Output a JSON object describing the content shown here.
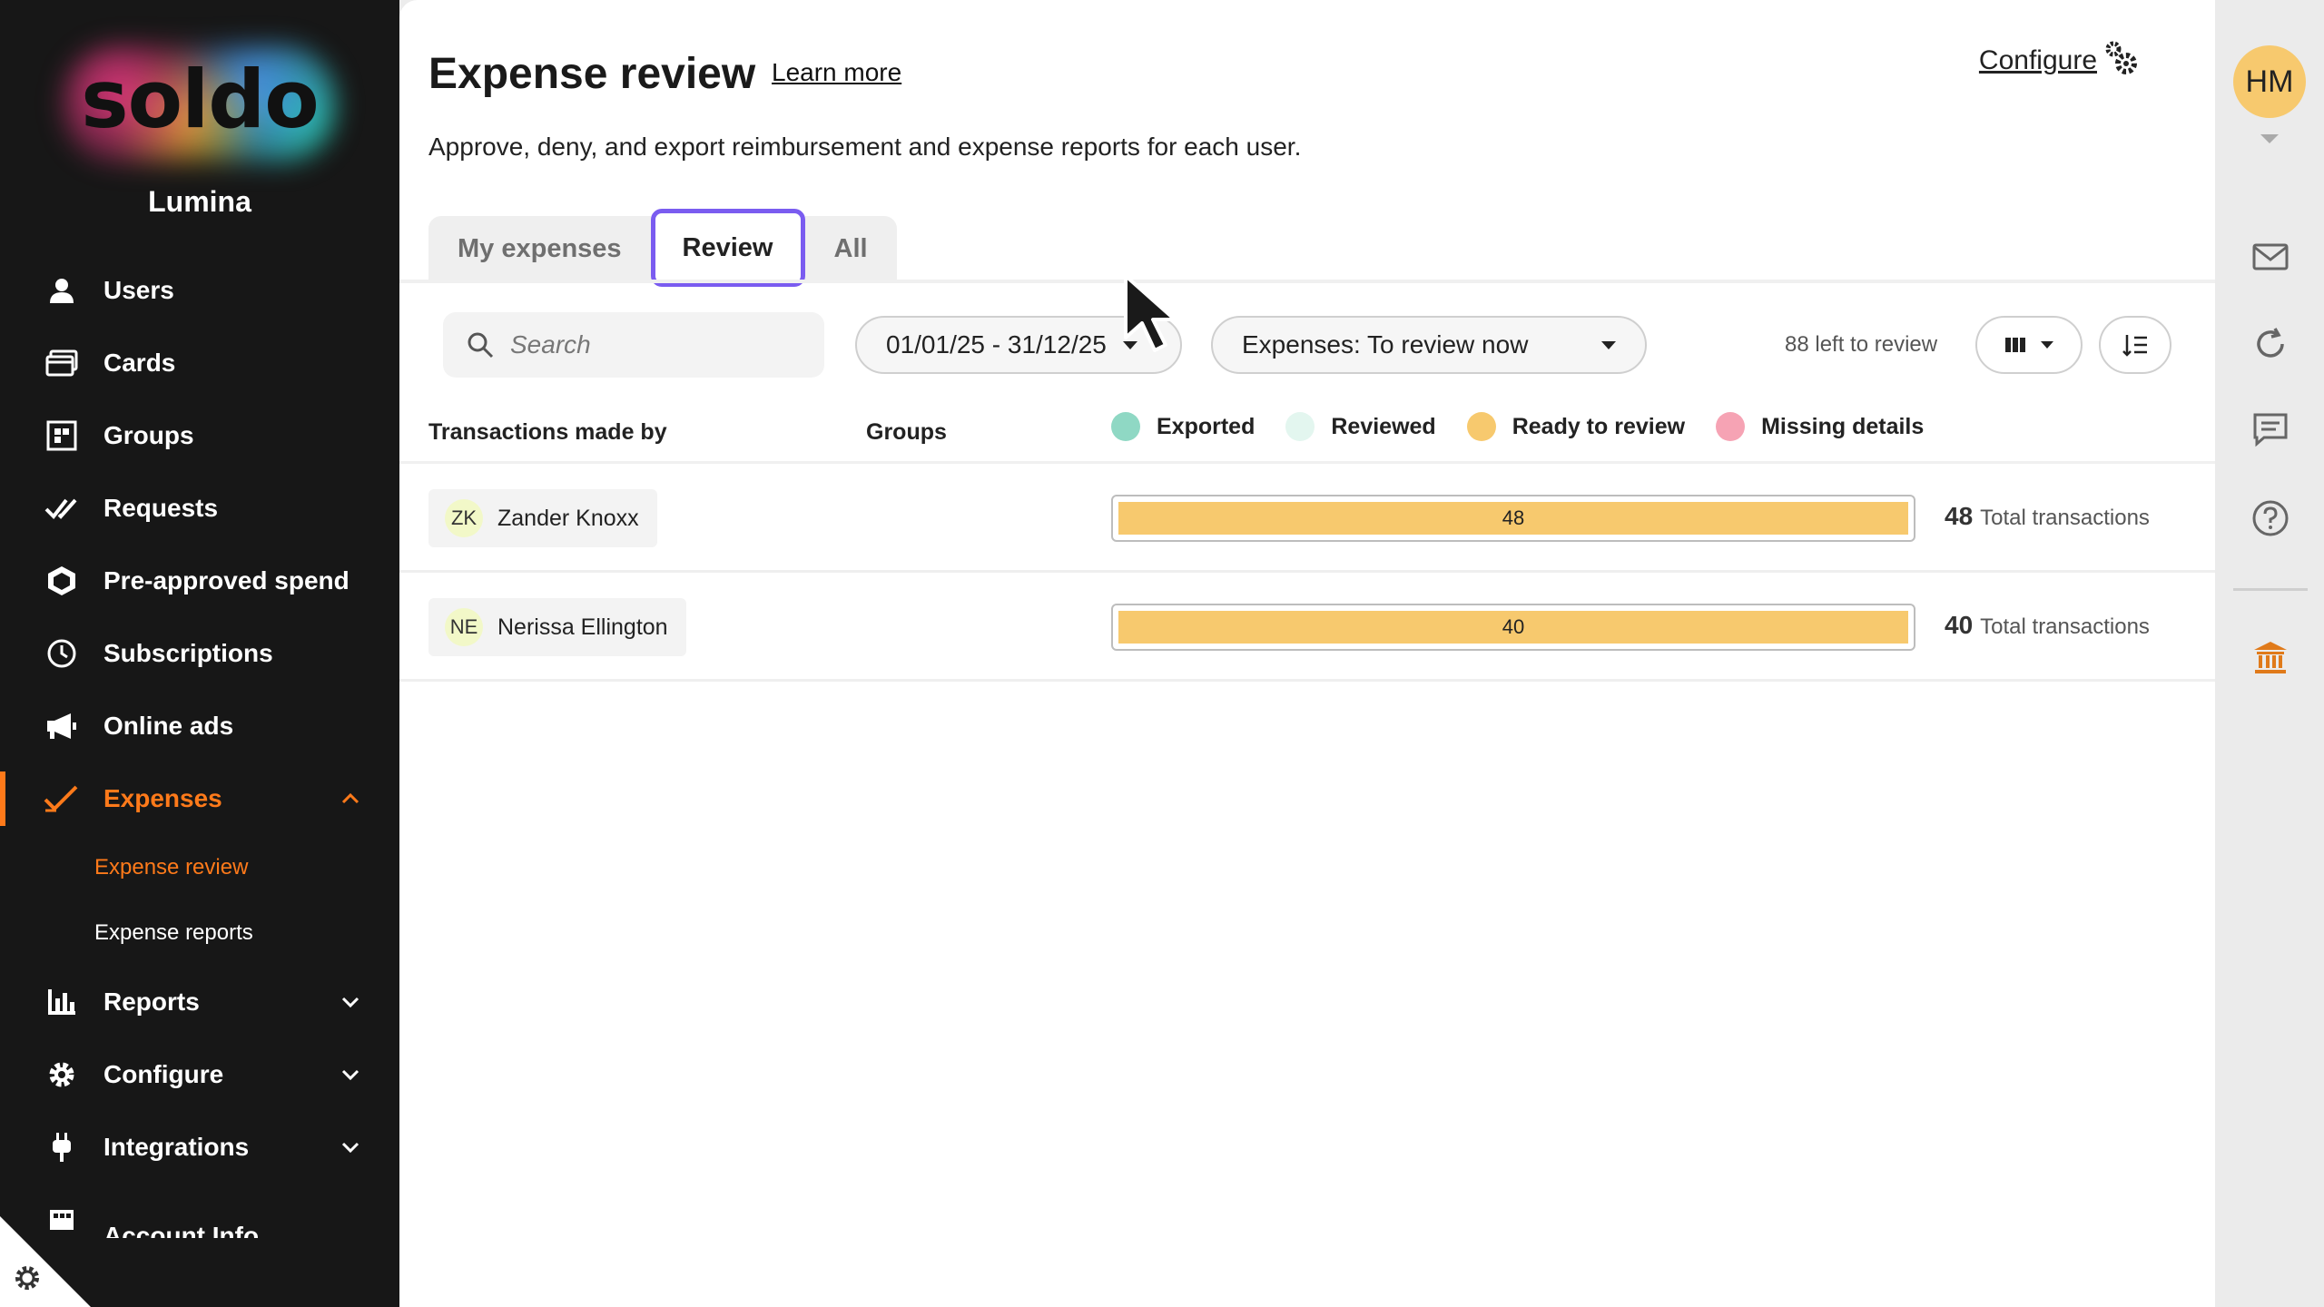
{
  "brand": {
    "logo_text": "soldo",
    "company": "Lumina"
  },
  "sidebar": {
    "items": [
      {
        "label": "Users",
        "icon": "user-icon"
      },
      {
        "label": "Cards",
        "icon": "cards-icon"
      },
      {
        "label": "Groups",
        "icon": "groups-icon"
      },
      {
        "label": "Requests",
        "icon": "requests-icon"
      },
      {
        "label": "Pre-approved spend",
        "icon": "pre-approved-icon"
      },
      {
        "label": "Subscriptions",
        "icon": "subscriptions-icon"
      },
      {
        "label": "Online ads",
        "icon": "megaphone-icon"
      },
      {
        "label": "Expenses",
        "icon": "expenses-check-icon",
        "active": true,
        "expanded": true
      },
      {
        "label": "Reports",
        "icon": "bar-chart-icon"
      },
      {
        "label": "Configure",
        "icon": "gear-icon"
      },
      {
        "label": "Integrations",
        "icon": "plug-icon"
      },
      {
        "label": "Account Info",
        "icon": "account-info-icon"
      }
    ],
    "expenses_sub": [
      {
        "label": "Expense review",
        "active": true
      },
      {
        "label": "Expense reports",
        "active": false
      }
    ],
    "accent": "#ff7a1a"
  },
  "header": {
    "title": "Expense review",
    "learn_more": "Learn more",
    "subtitle": "Approve, deny, and export reimbursement and expense reports for each user.",
    "configure": "Configure"
  },
  "tabs": [
    {
      "label": "My expenses",
      "active": false
    },
    {
      "label": "Review",
      "active": true
    },
    {
      "label": "All",
      "active": false
    }
  ],
  "toolbar": {
    "search_placeholder": "Search",
    "date_range": "01/01/25 - 31/12/25",
    "filter": "Expenses: To review now",
    "left_to_review": "88 left to review"
  },
  "table": {
    "col_user": "Transactions made by",
    "col_groups": "Groups",
    "legend": [
      {
        "label": "Exported",
        "color": "#8fd8c4"
      },
      {
        "label": "Reviewed",
        "color": "#e3f6ef"
      },
      {
        "label": "Ready to review",
        "color": "#f7c96e"
      },
      {
        "label": "Missing details",
        "color": "#f6a3b4"
      }
    ],
    "rows": [
      {
        "initials": "ZK",
        "name": "Zander Knoxx",
        "ready": 48,
        "total": "48",
        "total_label": "Total transactions"
      },
      {
        "initials": "NE",
        "name": "Nerissa Ellington",
        "ready": 40,
        "total": "40",
        "total_label": "Total transactions"
      }
    ]
  },
  "rail": {
    "avatar_initials": "HM",
    "accent": "#e07a1a"
  }
}
